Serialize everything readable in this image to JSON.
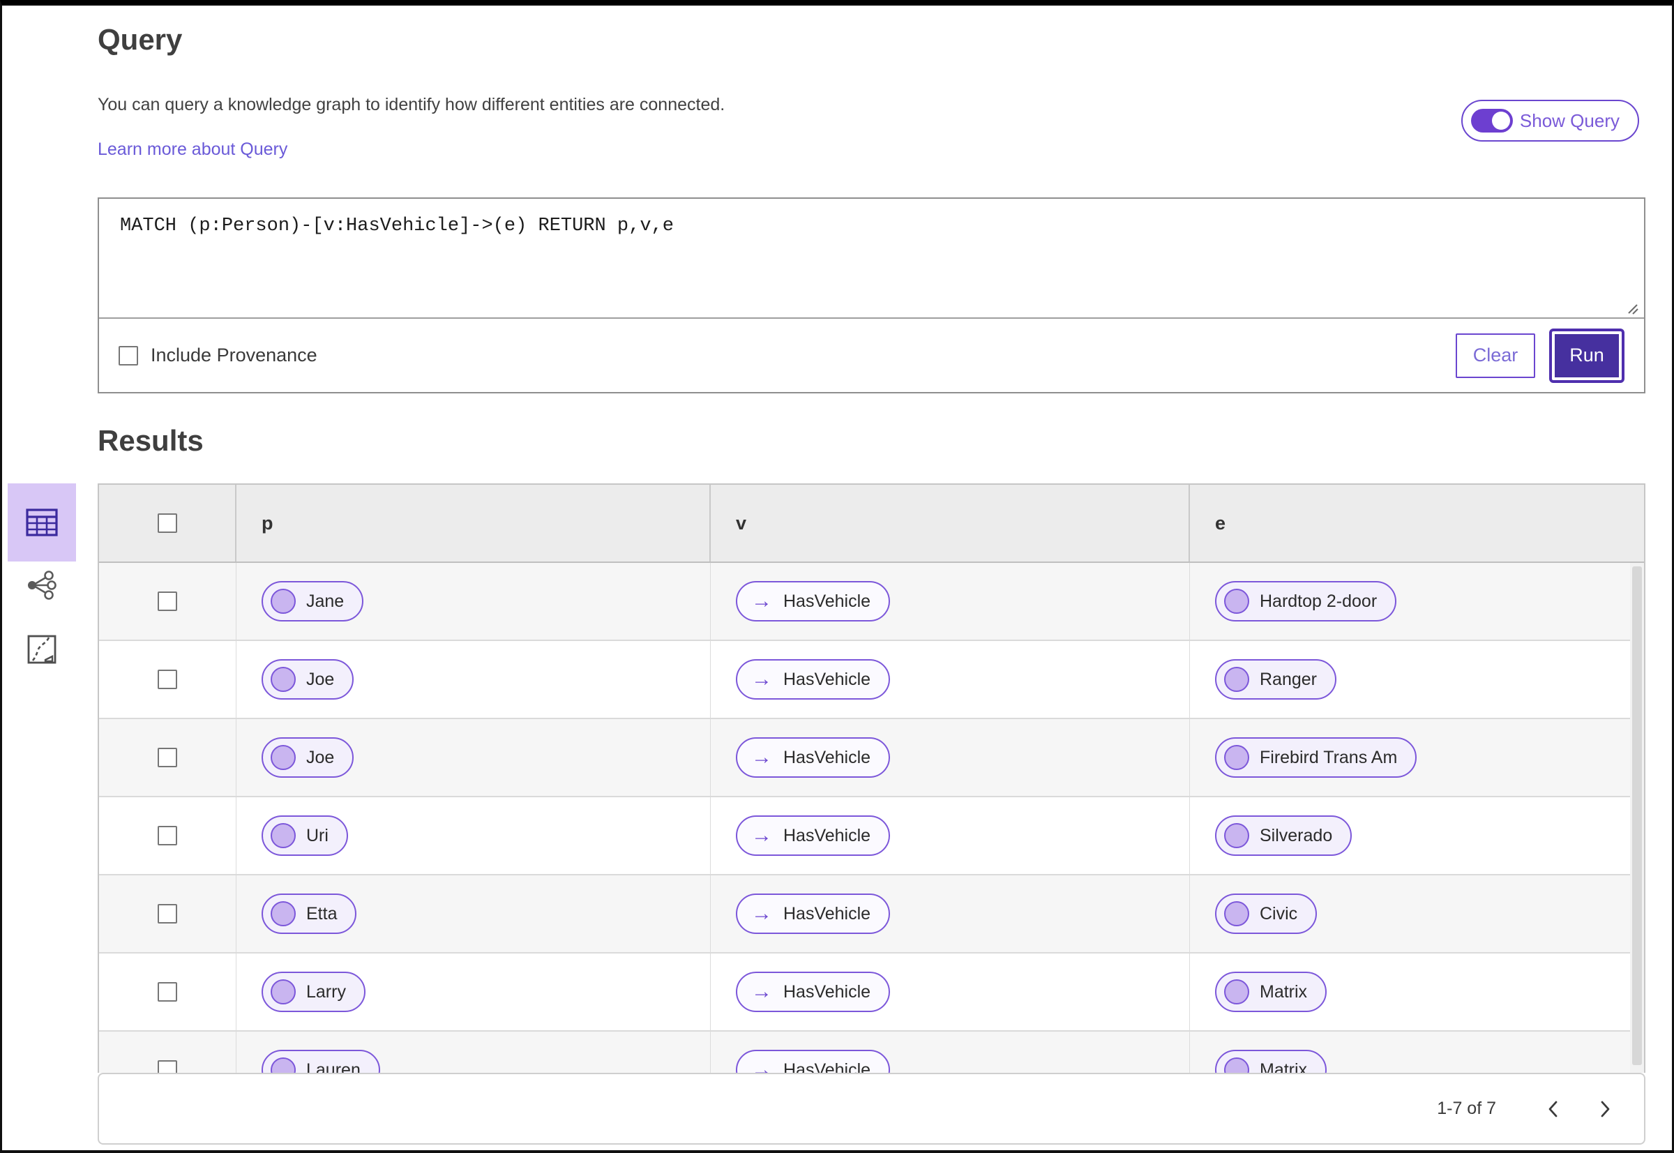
{
  "query_section": {
    "title": "Query",
    "description": "You can query a knowledge graph to identify how different entities are connected.",
    "learn_more_link": "Learn more about Query",
    "show_query_label": "Show Query",
    "show_query_on": true,
    "query_text": "MATCH (p:Person)-[v:HasVehicle]->(e) RETURN p,v,e",
    "include_provenance_label": "Include Provenance",
    "include_provenance_checked": false,
    "clear_label": "Clear",
    "run_label": "Run"
  },
  "results_section": {
    "title": "Results"
  },
  "sidebar": {
    "items": [
      {
        "id": "table-view",
        "icon": "table-icon",
        "selected": true
      },
      {
        "id": "graph-view",
        "icon": "graph-icon",
        "selected": false
      },
      {
        "id": "map-view",
        "icon": "map-icon",
        "selected": false
      }
    ]
  },
  "table": {
    "columns": [
      "p",
      "v",
      "e"
    ],
    "rows": [
      {
        "p": "Jane",
        "v": "HasVehicle",
        "e": "Hardtop 2-door"
      },
      {
        "p": "Joe",
        "v": "HasVehicle",
        "e": "Ranger"
      },
      {
        "p": "Joe",
        "v": "HasVehicle",
        "e": "Firebird Trans Am"
      },
      {
        "p": "Uri",
        "v": "HasVehicle",
        "e": "Silverado"
      },
      {
        "p": "Etta",
        "v": "HasVehicle",
        "e": "Civic"
      },
      {
        "p": "Larry",
        "v": "HasVehicle",
        "e": "Matrix"
      },
      {
        "p": "Lauren",
        "v": "HasVehicle",
        "e": "Matrix"
      }
    ]
  },
  "pagination": {
    "range_label": "1-7 of 7"
  },
  "icons": {
    "edge_arrow": "→"
  },
  "colors": {
    "accent_purple": "#6a46cf",
    "run_button": "#46309f",
    "pill_border": "#7c57da",
    "pill_background": "#f3f0fc",
    "selected_tile": "#d8c7f6",
    "header_background": "#ececec",
    "alt_row_background": "#f6f6f6"
  }
}
